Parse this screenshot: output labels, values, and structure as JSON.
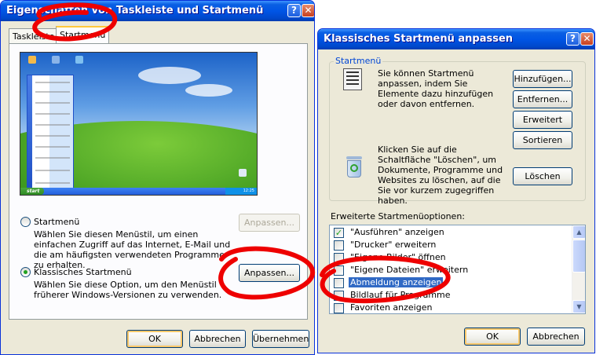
{
  "left_window": {
    "title": "Eigenschaften von Taskleiste und Startmenü",
    "title_buttons": {
      "help": "?",
      "close": "✕"
    },
    "tabs": [
      {
        "label": "Taskleiste",
        "active": false
      },
      {
        "label": "Startmenü",
        "active": true
      }
    ],
    "preview": {
      "start_label": "start",
      "tray_time": "12:25"
    },
    "options": [
      {
        "label": "Startmenü",
        "selected": false,
        "description": "Wählen Sie diesen Menüstil, um einen einfachen Zugriff auf das Internet, E-Mail und die am häufigsten verwendeten Programme zu erhalten.",
        "button": "Anpassen...",
        "button_enabled": false
      },
      {
        "label": "Klassisches Startmenü",
        "selected": true,
        "description": "Wählen Sie diese Option, um den Menüstil früherer Windows-Versionen zu verwenden.",
        "button": "Anpassen...",
        "button_enabled": true
      }
    ],
    "footer_buttons": {
      "ok": "OK",
      "cancel": "Abbrechen",
      "apply": "Übernehmen"
    }
  },
  "right_window": {
    "title": "Klassisches Startmenü anpassen",
    "title_buttons": {
      "help": "?",
      "close": "✕"
    },
    "group_label": "Startmenü",
    "customize_text": "Sie können Startmenü anpassen, indem Sie Elemente dazu hinzufügen oder davon entfernen.",
    "buttons": {
      "add": "Hinzufügen...",
      "remove": "Entfernen...",
      "advanced": "Erweitert",
      "sort": "Sortieren",
      "clear": "Löschen"
    },
    "clear_text": "Klicken Sie auf die Schaltfläche \"Löschen\", um Dokumente, Programme und Websites zu löschen, auf die Sie vor kurzem zugegriffen haben.",
    "advanced_label": "Erweiterte Startmenüoptionen:",
    "options": [
      {
        "label": "\"Ausführen\" anzeigen",
        "checked": true,
        "selected": false
      },
      {
        "label": "\"Drucker\" erweitern",
        "checked": false,
        "selected": false
      },
      {
        "label": "\"Eigene Bilder\" öffnen",
        "checked": false,
        "selected": false
      },
      {
        "label": "\"Eigene Dateien\" erweitern",
        "checked": false,
        "selected": false
      },
      {
        "label": "Abmeldung anzeigen",
        "checked": false,
        "selected": true
      },
      {
        "label": "Bildlauf für Programme",
        "checked": false,
        "selected": false
      },
      {
        "label": "Favoriten anzeigen",
        "checked": false,
        "selected": false
      }
    ],
    "footer_buttons": {
      "ok": "OK",
      "cancel": "Abbrechen"
    }
  }
}
